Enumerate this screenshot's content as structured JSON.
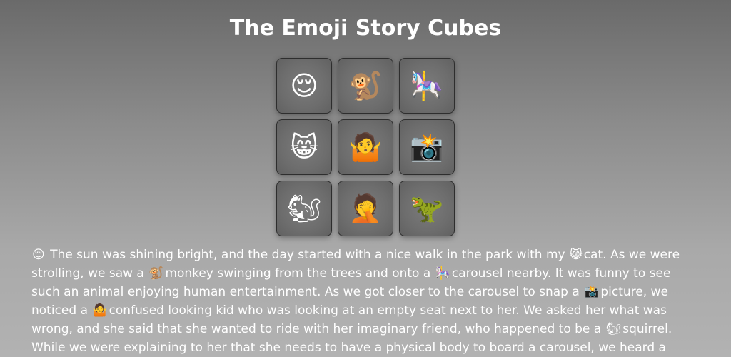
{
  "title": "The Emoji Story Cubes",
  "cubes": [
    {
      "emoji": "😌",
      "icon": "relieved-face-icon"
    },
    {
      "emoji": "🐒",
      "icon": "monkey-icon"
    },
    {
      "emoji": "🎠",
      "icon": "carousel-horse-icon"
    },
    {
      "emoji": "😸",
      "icon": "grinning-cat-icon"
    },
    {
      "emoji": "🤷",
      "icon": "person-shrugging-icon"
    },
    {
      "emoji": "📸",
      "icon": "camera-with-flash-icon"
    },
    {
      "emoji": "🐿",
      "icon": "chipmunk-icon"
    },
    {
      "emoji": "🤦",
      "icon": "person-facepalming-icon"
    },
    {
      "emoji": "🦖",
      "icon": "t-rex-icon"
    }
  ],
  "story": [
    {
      "type": "emoji",
      "value": "😌"
    },
    {
      "type": "text",
      "value": " The sun was shining bright, and the day started with a nice walk in the park with my "
    },
    {
      "type": "emoji",
      "value": "😸"
    },
    {
      "type": "text",
      "value": "cat. As we were strolling, we saw a "
    },
    {
      "type": "emoji",
      "value": "🐒"
    },
    {
      "type": "text",
      "value": "monkey swinging from the trees and onto a "
    },
    {
      "type": "emoji",
      "value": "🎠"
    },
    {
      "type": "text",
      "value": "carousel nearby. It was funny to see such an animal enjoying human entertainment. As we got closer to the carousel to snap a "
    },
    {
      "type": "emoji",
      "value": "📸"
    },
    {
      "type": "text",
      "value": "picture, we noticed a "
    },
    {
      "type": "emoji",
      "value": "🤷"
    },
    {
      "type": "text",
      "value": "confused looking kid who was looking at an empty seat next to her. We asked her what was wrong, and she said that she wanted to ride with her imaginary friend, who happened to be a "
    },
    {
      "type": "emoji",
      "value": "🐿"
    },
    {
      "type": "text",
      "value": "squirrel. While we were explaining to her that she needs to have a physical body to board a carousel, we heard a"
    }
  ]
}
